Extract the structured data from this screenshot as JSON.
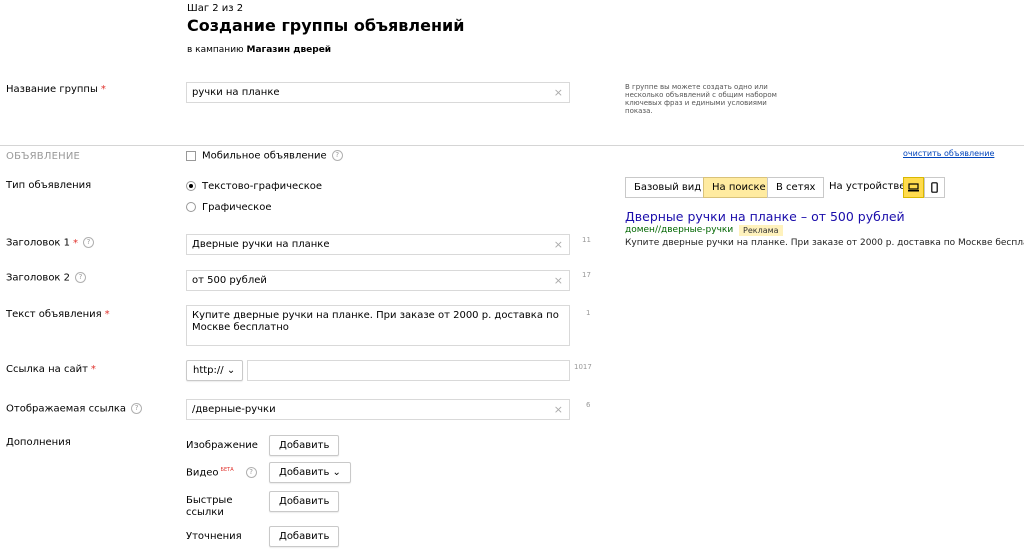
{
  "header": {
    "step": "Шаг 2 из 2",
    "title": "Создание группы объявлений",
    "campaign_prefix": "в кампанию",
    "campaign_name": "Магазин дверей"
  },
  "group": {
    "label": "Название группы",
    "required": "*",
    "value": "ручки на планке",
    "hint": "В группе вы можете создать одно или несколько объявлений с общим набором ключевых фраз и едиными условиями показа."
  },
  "ad_section": {
    "title": "ОБЪЯВЛЕНИЕ",
    "mobile_label": "Мобильное объявление",
    "clear_link": "очистить объявление"
  },
  "ad_type": {
    "label": "Тип объявления",
    "options": [
      "Текстово-графическое",
      "Графическое"
    ],
    "selected_index": 0
  },
  "fields": {
    "title1": {
      "label": "Заголовок 1",
      "required": "*",
      "value": "Дверные ручки на планке",
      "counter": "11"
    },
    "title2": {
      "label": "Заголовок 2",
      "value": "от 500 рублей",
      "counter": "17"
    },
    "text": {
      "label": "Текст объявления",
      "required": "*",
      "value": "Купите дверные ручки на планке. При заказе от 2000 р. доставка по Москве бесплатно",
      "counter": "1"
    },
    "link": {
      "label": "Ссылка на сайт",
      "required": "*",
      "protocol": "http://",
      "value": "",
      "counter": "1017"
    },
    "display_link": {
      "label": "Отображаемая ссылка",
      "value": "/дверные-ручки",
      "counter": "6"
    }
  },
  "extras": {
    "label": "Дополнения",
    "image_label": "Изображение",
    "video_label": "Видео",
    "video_badge": "БЕТА",
    "quicklinks_label_1": "Быстрые",
    "quicklinks_label_2": "ссылки",
    "clarifications_label": "Уточнения",
    "add_label": "Добавить"
  },
  "preview": {
    "tabs": [
      "Базовый вид",
      "На поиске",
      "В сетях"
    ],
    "active_tab": 1,
    "device_label": "На устройстве",
    "devices": [
      "desktop-icon",
      "mobile-icon"
    ],
    "active_device": 0,
    "ad_title": "Дверные ручки на планке – от 500 рублей",
    "ad_domain": "домен//дверные-ручки",
    "ad_badge": "Реклама",
    "ad_text": "Купите дверные ручки на планке. При заказе от 2000 р. доставка по Москве бесплатно"
  },
  "colors": {
    "required": "#e0302b",
    "link": "#1a0dab",
    "domain": "#006600",
    "active_tab": "#ffeba0",
    "active_device": "#ffdb4d"
  },
  "help_icon": "?",
  "clear_icon": "×"
}
